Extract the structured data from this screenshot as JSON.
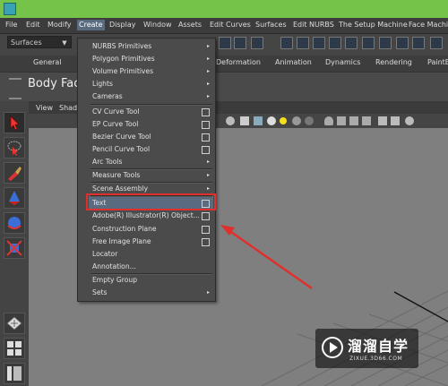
{
  "menubar": {
    "items": [
      "File",
      "Edit",
      "Modify",
      "Create",
      "Display",
      "Window",
      "Assets",
      "Edit Curves",
      "Surfaces",
      "Edit NURBS",
      "The Setup Machine",
      "Face Machine"
    ]
  },
  "shelf": {
    "mode_dropdown": "Surfaces"
  },
  "tabs": [
    "General",
    "Deformation",
    "Animation",
    "Dynamics",
    "Rendering",
    "PaintE"
  ],
  "shelf_title": "Body Face",
  "viewport_menu": [
    "View",
    "Shad"
  ],
  "create_menu": {
    "items": [
      {
        "label": "NURBS Primitives",
        "arrow": "▸"
      },
      {
        "label": "Polygon Primitives",
        "arrow": "▸"
      },
      {
        "label": "Volume Primitives",
        "arrow": "▸"
      },
      {
        "label": "Lights",
        "arrow": "▸"
      },
      {
        "label": "Cameras",
        "arrow": "▸"
      },
      {
        "label": "CV Curve Tool"
      },
      {
        "label": "EP Curve Tool"
      },
      {
        "label": "Bezier Curve Tool"
      },
      {
        "label": "Pencil Curve Tool"
      },
      {
        "label": "Arc Tools",
        "arrow": "▸"
      },
      {
        "label": "Measure Tools",
        "arrow": "▸"
      },
      {
        "label": "Scene Assembly",
        "arrow": "▸"
      },
      {
        "label": "Text"
      },
      {
        "label": "Adobe(R) Illustrator(R) Object..."
      },
      {
        "label": "Construction Plane"
      },
      {
        "label": "Free Image Plane"
      },
      {
        "label": "Locator"
      },
      {
        "label": "Annotation..."
      },
      {
        "label": "Empty Group"
      },
      {
        "label": "Sets",
        "arrow": "▸"
      }
    ]
  },
  "watermark": {
    "title": "溜溜自学",
    "subtitle": "ZIXUE.3D66.COM"
  },
  "colors": {
    "accent_green": "#76c34a",
    "highlight_red": "#e0302d",
    "menu_highlight": "#5a6b80"
  }
}
